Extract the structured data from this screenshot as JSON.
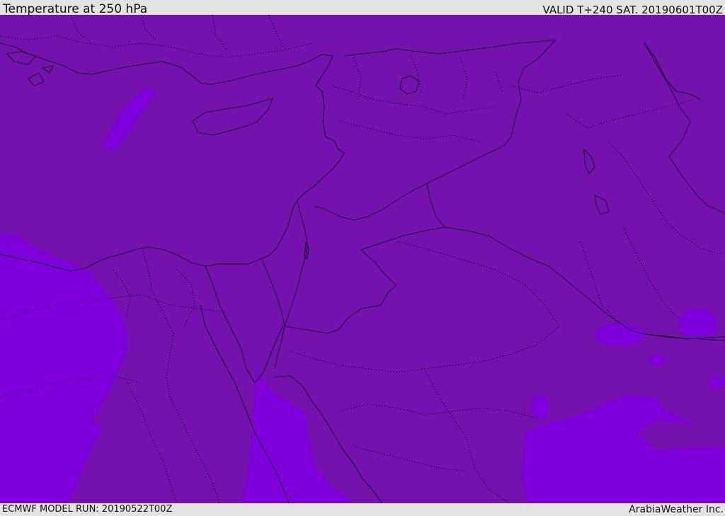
{
  "header": {
    "title": "Temperature at 250 hPa",
    "valid_time": "VALID T+240 SAT. 20190601T00Z"
  },
  "footer": {
    "model_run": "ECMWF MODEL RUN: 20190522T00Z",
    "credit": "ArabiaWeather Inc."
  },
  "map": {
    "colors": {
      "base_field": "#7512ae",
      "warm_field": "#7f00dd",
      "coastline": "#1a0a2e",
      "border": "#1a0a2e"
    }
  }
}
